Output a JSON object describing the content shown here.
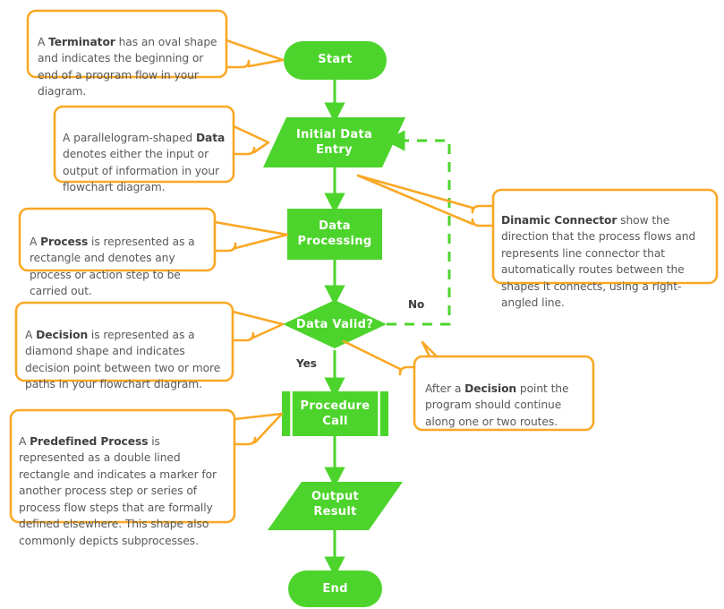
{
  "colors": {
    "shape_fill": "#4dd42c",
    "shape_text": "#ffffff",
    "connector": "#4dd42c",
    "callout_border": "#f9a825",
    "note_text": "#58595b",
    "edge_label": "#3b3b3b",
    "background": "#ffffff"
  },
  "diagram": {
    "title": "Flowchart shapes legend",
    "nodes": [
      {
        "id": "start",
        "type": "terminator",
        "label": "Start"
      },
      {
        "id": "input",
        "type": "data",
        "label": "Initial Data\nEntry"
      },
      {
        "id": "process",
        "type": "process",
        "label": "Data\nProcessing"
      },
      {
        "id": "decision",
        "type": "decision",
        "label": "Data Valid?"
      },
      {
        "id": "procedure",
        "type": "predefined-process",
        "label": "Procedure\nCall"
      },
      {
        "id": "output",
        "type": "data",
        "label": "Output\nResult"
      },
      {
        "id": "end",
        "type": "terminator",
        "label": "End"
      }
    ],
    "edges": [
      {
        "from": "start",
        "to": "input",
        "label": "",
        "style": "solid"
      },
      {
        "from": "input",
        "to": "process",
        "label": "",
        "style": "solid"
      },
      {
        "from": "process",
        "to": "decision",
        "label": "",
        "style": "solid"
      },
      {
        "from": "decision",
        "to": "procedure",
        "label": "Yes",
        "style": "solid"
      },
      {
        "from": "decision",
        "to": "input",
        "label": "No",
        "style": "dashed"
      },
      {
        "from": "procedure",
        "to": "output",
        "label": "",
        "style": "solid"
      },
      {
        "from": "output",
        "to": "end",
        "label": "",
        "style": "solid"
      }
    ],
    "edge_labels": {
      "yes": "Yes",
      "no": "No"
    }
  },
  "notes": {
    "terminator": {
      "lead": "A ",
      "term": "Terminator",
      "rest": " has an oval shape and indicates the beginning or end of a program flow in your diagram."
    },
    "data": {
      "lead": "A parallelogram-shaped ",
      "term": "Data",
      "rest": " denotes either the input or output of information in your flowchart diagram."
    },
    "process": {
      "lead": "A ",
      "term": "Process",
      "rest": " is represented as a rectangle and denotes any process or action step to be carried out."
    },
    "decision": {
      "lead": "A ",
      "term": "Decision",
      "rest": " is represented as a diamond shape and indicates decision point between two or more paths in your flowchart diagram."
    },
    "predefined": {
      "lead": "A ",
      "term": "Predefined Process",
      "rest": " is represented as a double lined rectangle and indicates a marker for another process step or series of process flow steps that are formally defined elsewhere. This shape also commonly depicts subprocesses."
    },
    "connector": {
      "lead": "",
      "term": "Dinamic Connector",
      "rest": " show the direction that the process flows and represents line connector that automatically routes between the shapes it connects, using a right-angled line."
    },
    "after_decision": {
      "lead": "After a ",
      "term": "Decision",
      "rest": " point the program should continue along one or two routes."
    }
  }
}
